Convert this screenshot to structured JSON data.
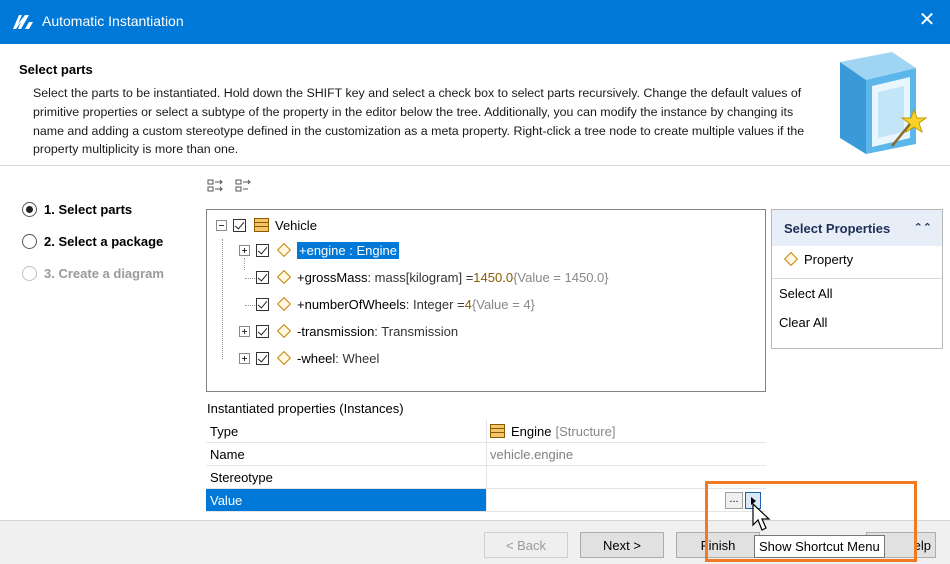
{
  "window": {
    "title": "Automatic Instantiation",
    "close_glyph": "✕"
  },
  "header": {
    "title": "Select parts",
    "description": "Select the parts to be instantiated. Hold down the SHIFT key and select a check box to select parts recursively. Change the default values of primitive properties or select a subtype of the property in the editor below the tree. Additionally, you can modify the instance by changing its name and adding a custom stereotype defined in the customization as a meta property. Right-click a tree node to create multiple values if the property multiplicity is more than one."
  },
  "steps": [
    {
      "label": "1. Select parts",
      "selected": true,
      "enabled": true
    },
    {
      "label": "2. Select a package",
      "selected": false,
      "enabled": true
    },
    {
      "label": "3. Create a diagram",
      "selected": false,
      "enabled": false
    }
  ],
  "tree": {
    "root": {
      "label": "Vehicle"
    },
    "children": [
      {
        "prefix": "+engine",
        "type": " : Engine",
        "value": "",
        "note": "",
        "selected": true,
        "expandable": true
      },
      {
        "prefix": "+grossMass",
        "type": " : mass[kilogram] = ",
        "value": "1450.0",
        "note": " {Value = 1450.0}",
        "selected": false,
        "expandable": false
      },
      {
        "prefix": "+numberOfWheels",
        "type": " : Integer = ",
        "value": "4",
        "note": " {Value = 4}",
        "selected": false,
        "expandable": false
      },
      {
        "prefix": "-transmission",
        "type": " : Transmission",
        "value": "",
        "note": "",
        "selected": false,
        "expandable": true
      },
      {
        "prefix": "-wheel",
        "type": " : Wheel",
        "value": "",
        "note": "",
        "selected": false,
        "expandable": true
      }
    ]
  },
  "right_panel": {
    "title": "Select Properties",
    "collapse_glyph": "⌃⌃",
    "item": "Property",
    "select_all": "Select All",
    "clear_all": "Clear All"
  },
  "properties": {
    "label": "Instantiated properties (Instances)",
    "rows": [
      {
        "key": "Type",
        "value": "Engine",
        "value_note": "[Structure]"
      },
      {
        "key": "Name",
        "value": "vehicle.engine"
      },
      {
        "key": "Stereotype",
        "value": ""
      },
      {
        "key": "Value",
        "value": ""
      }
    ],
    "ellipsis_label": "..."
  },
  "footer": {
    "back": "< Back",
    "next": "Next >",
    "finish": "Finish",
    "help_tail": "elp"
  },
  "tooltip": "Show Shortcut Menu",
  "colors": {
    "titlebar": "#0078d7",
    "selection": "#0078d7",
    "highlight": "#f07b22"
  }
}
